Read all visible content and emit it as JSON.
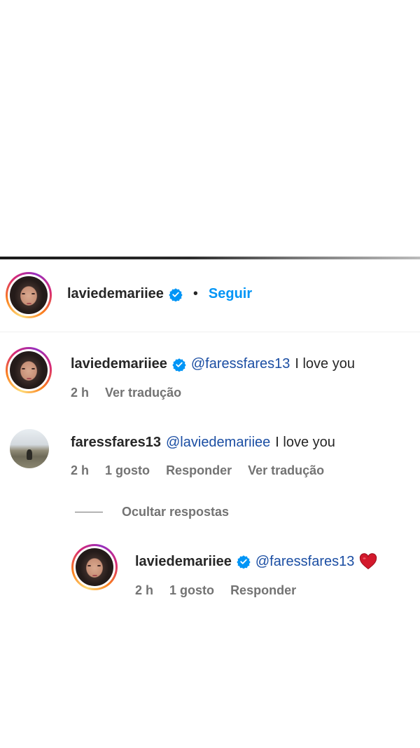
{
  "header": {
    "username": "laviedemariiee",
    "separator": "•",
    "follow_label": "Seguir"
  },
  "comments": [
    {
      "username": "laviedemariiee",
      "mention": "@faressfares13",
      "text": "I love you",
      "time": "2 h",
      "translate": "Ver tradução"
    },
    {
      "username": "faressfares13",
      "mention": "@laviedemariiee",
      "text": "I love you",
      "time": "2 h",
      "likes": "1 gosto",
      "reply": "Responder",
      "translate": "Ver tradução"
    }
  ],
  "hide_replies_label": "Ocultar respostas",
  "reply": {
    "username": "laviedemariiee",
    "mention": "@faressfares13",
    "emoji": "heart-icon",
    "time": "2 h",
    "likes": "1 gosto",
    "reply": "Responder"
  },
  "colors": {
    "link_blue": "#0095f6",
    "mention_blue": "#1b4ea3",
    "muted_gray": "#737373",
    "heart_red": "#e0245e",
    "verified_blue": "#0095f6"
  }
}
